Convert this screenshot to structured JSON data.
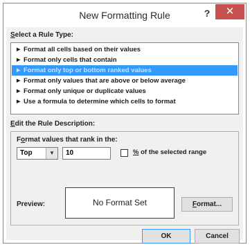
{
  "window": {
    "title": "New Formatting Rule",
    "help_label": "?",
    "close_label": "✕"
  },
  "rule_type": {
    "label_underlined": "S",
    "label_rest": "elect a Rule Type:",
    "items": [
      {
        "label": "Format all cells based on their values"
      },
      {
        "label": "Format only cells that contain"
      },
      {
        "label": "Format only top or bottom ranked values"
      },
      {
        "label": "Format only values that are above or below average"
      },
      {
        "label": "Format only unique or duplicate values"
      },
      {
        "label": "Use a formula to determine which cells to format"
      }
    ],
    "arrow_glyph": "►",
    "selected_index": 2
  },
  "description": {
    "label_underlined": "E",
    "label_rest": "dit the Rule Description:",
    "format_label_pre": "F",
    "format_label_underlined": "o",
    "format_label_rest": "rmat values that rank in the:",
    "rank_select_value": "Top",
    "rank_number_value": "10",
    "percent_checkbox_checked": false,
    "percent_label_pre": "",
    "percent_label_underlined": "%",
    "percent_label_rest": " of the selected range",
    "preview_label": "Preview:",
    "preview_text": "No Format Set",
    "format_button_underlined": "F",
    "format_button_rest": "ormat..."
  },
  "buttons": {
    "ok": "OK",
    "cancel": "Cancel"
  },
  "colors": {
    "selection": "#3399ff",
    "close_button": "#c75050",
    "dialog_body": "#f0f0f0"
  }
}
